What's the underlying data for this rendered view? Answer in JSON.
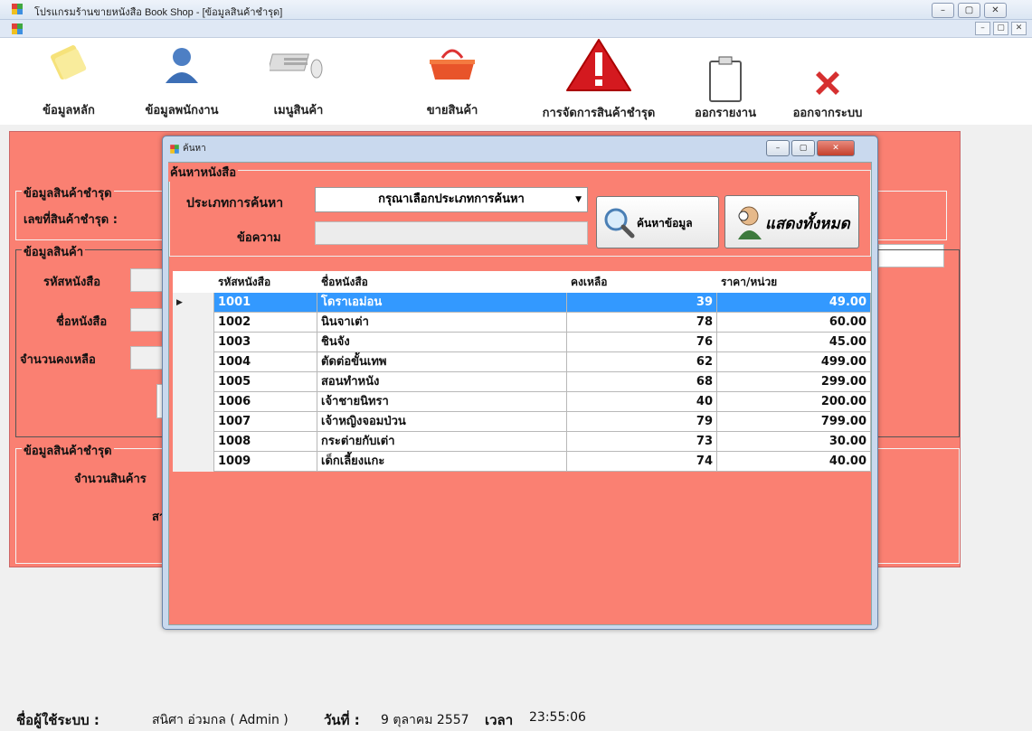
{
  "window": {
    "title": "โปรแกรมร้านขายหนังสือ Book Shop - [ข้อมูลสินค้าชำรุด]",
    "controls": [
      "–",
      "▢",
      "✕"
    ],
    "mdi_controls": [
      "–",
      "▢",
      "✕"
    ]
  },
  "toolbar": [
    {
      "label": "ข้อมูลหลัก",
      "icon": "note-icon"
    },
    {
      "label": "ข้อมูลพนักงาน",
      "icon": "user-icon"
    },
    {
      "label": "เมนูสินค้า",
      "icon": "keyboard-icon"
    },
    {
      "label": "ขายสินค้า",
      "icon": "basket-icon"
    },
    {
      "label": "การจัดการสินค้าชำรุด",
      "icon": "warning-icon"
    },
    {
      "label": "ออกรายงาน",
      "icon": "clipboard-icon"
    },
    {
      "label": "ออกจากระบบ",
      "icon": "red-x-icon"
    }
  ],
  "background_form": {
    "group1_title": "ข้อมูลสินค้าชำรุด",
    "damaged_id_label": "เลขที่สินค้าชำรุด :",
    "group2_title": "ข้อมูลสินค้า",
    "book_id_label": "รหัสหนังสือ",
    "book_name_label": "ชื่อหนังสือ",
    "remaining_label": "จำนวนคงเหลือ",
    "group3_title": "ข้อมูลสินค้าชำรุด",
    "qty_label": "จำนวนสินค้าร",
    "other_label": "สา"
  },
  "dialog": {
    "title": "ค้นหา",
    "group_title": "ค้นหาหนังสือ",
    "search_type_label": "ประเภทการค้นหา",
    "search_type_value": "กรุณาเลือกประเภทการค้นหา",
    "message_label": "ข้อความ",
    "message_value": "",
    "search_button": "ค้นหาข้อมูล",
    "show_all_button": "แสดงทั้งหมด",
    "grid": {
      "columns": [
        "รหัสหนังสือ",
        "ชื่อหนังสือ",
        "คงเหลือ",
        "ราคา/หน่วย"
      ],
      "rows": [
        [
          "1001",
          "โดราเอม่อน",
          "39",
          "49.00"
        ],
        [
          "1002",
          "นินจาเต่า",
          "78",
          "60.00"
        ],
        [
          "1003",
          "ชินจัง",
          "76",
          "45.00"
        ],
        [
          "1004",
          "ตัดต่อขั้นเทพ",
          "62",
          "499.00"
        ],
        [
          "1005",
          "สอนทำหนัง",
          "68",
          "299.00"
        ],
        [
          "1006",
          "เจ้าชายนิทรา",
          "40",
          "200.00"
        ],
        [
          "1007",
          "เจ้าหญิงจอมป่วน",
          "79",
          "799.00"
        ],
        [
          "1008",
          "กระต่ายกับเต่า",
          "73",
          "30.00"
        ],
        [
          "1009",
          "เด็กเลี้ยงแกะ",
          "74",
          "40.00"
        ]
      ],
      "selected_row": 0,
      "selection_color": "#3399ff"
    }
  },
  "statusbar": {
    "user_label": "ชื่อผู้ใช้ระบบ :",
    "user_value": "สนิศา อ่วมกล ( Admin )",
    "date_label": "วันที่ :",
    "date_value": "9 ตุลาคม 2557",
    "time_label": "เวลา",
    "time_value": "23:55:06"
  },
  "colors": {
    "form_background": "#fa8072",
    "selection": "#3399ff"
  }
}
